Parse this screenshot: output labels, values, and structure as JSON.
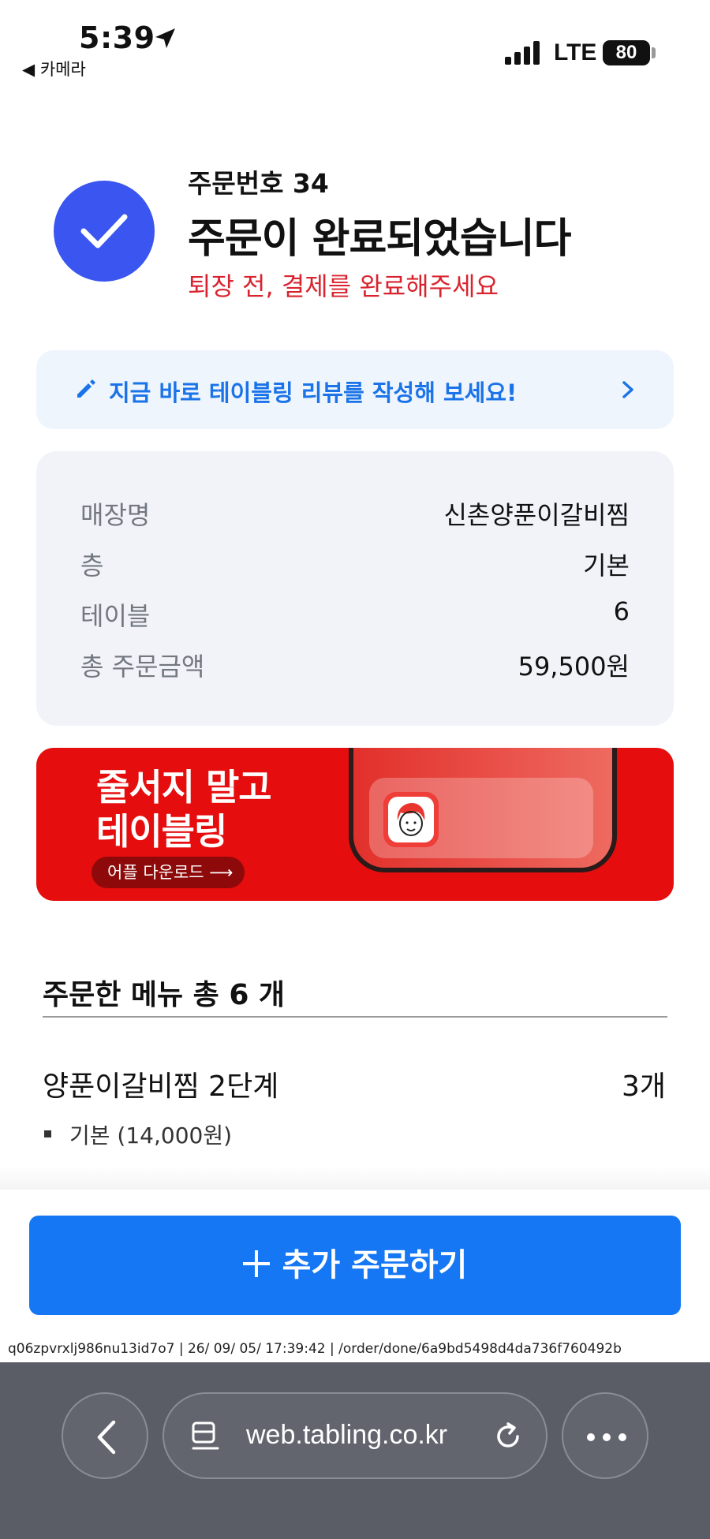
{
  "status_bar": {
    "time": "5:39",
    "back_app": "◀ 카메라",
    "network": "LTE",
    "battery": "80"
  },
  "order": {
    "number_label": "주문번호 34",
    "title": "주문이 완료되었습니다",
    "subtitle": "퇴장 전, 결제를 완료해주세요"
  },
  "review_banner": {
    "text": "지금 바로 테이블링 리뷰를 작성해 보세요!"
  },
  "info": {
    "rows": [
      {
        "label": "매장명",
        "value": "신촌양푼이갈비찜"
      },
      {
        "label": "층",
        "value": "기본"
      },
      {
        "label": "테이블",
        "value": "6"
      },
      {
        "label": "총 주문금액",
        "value": "59,500원"
      }
    ]
  },
  "promo": {
    "line1": "줄서지 말고",
    "line2": "테이블링",
    "button": "어플 다운로드 ⟶"
  },
  "menu": {
    "heading": "주문한 메뉴 총 6 개",
    "items": [
      {
        "name": "양푼이갈비찜 2단계",
        "qty": "3개",
        "option": "기본 (14,000원)"
      }
    ]
  },
  "actions": {
    "add_order": "추가 주문하기"
  },
  "debug_line": "q06zpvrxlj986nu13id7o7 | 26/ 09/ 05/ 17:39:42 | /order/done/6a9bd5498d4da736f760492b",
  "browser": {
    "url": "web.tabling.co.kr"
  },
  "colors": {
    "primary": "#1577f3",
    "check": "#3a55f0",
    "warning": "#d9242f",
    "promo": "#e50d0d"
  }
}
